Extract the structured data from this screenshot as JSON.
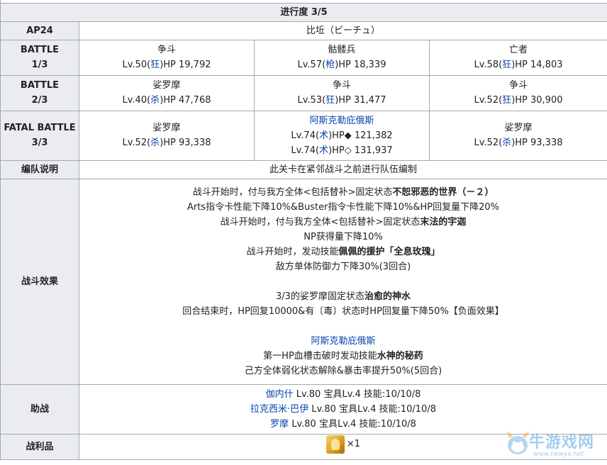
{
  "progress": "进行度 3/5",
  "ap": {
    "label": "AP24",
    "quest": "比坵（ビーチュ）"
  },
  "battle1": {
    "label1": "BATTLE",
    "label2": "1/3",
    "enemies": [
      {
        "name": "争斗",
        "lv": "Lv.50(",
        "cls": "狂",
        "hp": ")HP 19,792"
      },
      {
        "name": "骷髅兵",
        "lv": "Lv.57(",
        "cls": "枪",
        "hp": ")HP 18,339"
      },
      {
        "name": "亡者",
        "lv": "Lv.58(",
        "cls": "狂",
        "hp": ")HP 14,803"
      }
    ]
  },
  "battle2": {
    "label1": "BATTLE",
    "label2": "2/3",
    "enemies": [
      {
        "name": "娑罗摩",
        "lv": "Lv.40(",
        "cls": "杀",
        "hp": ")HP 47,768"
      },
      {
        "name": "争斗",
        "lv": "Lv.53(",
        "cls": "狂",
        "hp": ")HP 31,477"
      },
      {
        "name": "争斗",
        "lv": "Lv.52(",
        "cls": "狂",
        "hp": ")HP 30,900"
      }
    ]
  },
  "battle3": {
    "label1": "FATAL BATTLE",
    "label2": "3/3",
    "left": {
      "name": "娑罗摩",
      "lv": "Lv.52(",
      "cls": "杀",
      "hp": ")HP 93,338"
    },
    "center": {
      "name": "阿斯克勒庇俄斯",
      "row1": {
        "lv": "Lv.74(",
        "cls": "术",
        "hp": ")HP◆ 121,382"
      },
      "row2": {
        "lv": "Lv.74(",
        "cls": "术",
        "hp": ")HP◇ 131,937"
      }
    },
    "right": {
      "name": "娑罗摩",
      "lv": "Lv.52(",
      "cls": "杀",
      "hp": ")HP 93,338"
    }
  },
  "formation": {
    "label": "编队说明",
    "text": "此关卡在紧邻战斗之前进行队伍编制"
  },
  "effects": {
    "label": "战斗效果",
    "l1a": "战斗开始时，付与我方全体<包括替补>固定状态",
    "l1b": "不恕邪恶的世界（－２）",
    "l2": "Arts指令卡性能下降10%&Buster指令卡性能下降10%&HP回复量下降20%",
    "l3a": "战斗开始时，付与我方全体<包括替补>固定状态",
    "l3b": "末法的宇迦",
    "l4": "NP获得量下降10%",
    "l5a": "战斗开始时，发动技能",
    "l5b": "佩佩的援护「全息玫瑰」",
    "l6": "敌方单体防御力下降30%(3回合)",
    "l7a": "3/3的娑罗摩固定状态",
    "l7b": "治愈的神水",
    "l8": "回合结束时，HP回复10000&有〔毒〕状态时HP回复量下降50%【负面效果】",
    "l9": "阿斯克勒庇俄斯",
    "l10a": "第一HP血槽击破时发动技能",
    "l10b": "水神的秘药",
    "l11": "己方全体弱化状态解除&暴击率提升50%(5回合)"
  },
  "support": {
    "label": "助战",
    "rows": [
      {
        "name": "伽内什",
        "detail": " Lv.80 宝具Lv.4 技能:10/10/8"
      },
      {
        "name": "拉克西米·巴伊",
        "detail": " Lv.80 宝具Lv.4 技能:10/10/8"
      },
      {
        "name": "罗摩",
        "detail": " Lv.80 宝具Lv.4 技能:10/10/8"
      }
    ]
  },
  "loot": {
    "label": "战利品",
    "count": "×1",
    "icon": "gold-ember-icon"
  },
  "watermark": {
    "text": "牛游戏网",
    "url": "www.newyx.net"
  },
  "colors": {
    "header_bg": "#eaecf0",
    "border": "#a2a9b1",
    "link": "#0645ad"
  }
}
